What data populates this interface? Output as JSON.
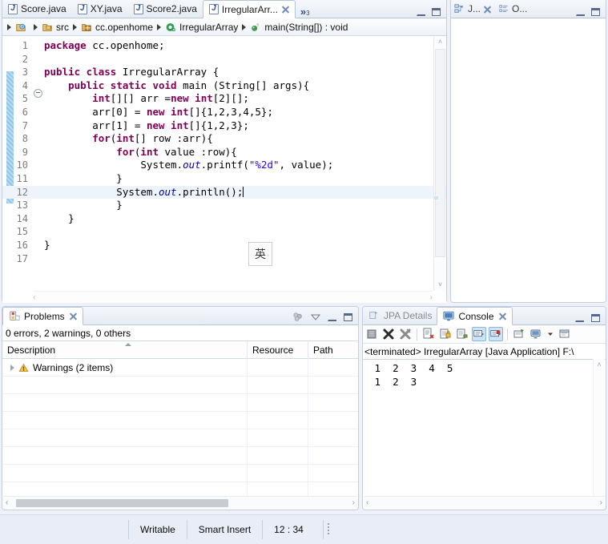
{
  "editor": {
    "tabs": [
      {
        "label": "Score.java",
        "icon": "java-file-icon",
        "active": false,
        "closable": false
      },
      {
        "label": "XY.java",
        "icon": "java-file-icon",
        "active": false,
        "closable": false
      },
      {
        "label": "Score2.java",
        "icon": "java-file-icon",
        "active": false,
        "closable": false
      },
      {
        "label": "IrregularArr...",
        "icon": "java-file-icon",
        "active": true,
        "closable": true
      }
    ],
    "more_tabs_chevron": "»",
    "more_tabs_count": "3",
    "minimize_icon": "minimize-icon",
    "maximize_icon": "maximize-icon",
    "breadcrumb": [
      {
        "label": "",
        "icon": "project-icon"
      },
      {
        "label": "src",
        "icon": "source-folder-icon"
      },
      {
        "label": "cc.openhome",
        "icon": "package-icon"
      },
      {
        "label": "IrregularArray",
        "icon": "class-icon"
      },
      {
        "label": "main(String[]) : void",
        "icon": "method-public-static-icon"
      }
    ],
    "code_lines": [
      {
        "num": "1",
        "fold": false,
        "tokens": [
          {
            "t": "package ",
            "c": "kw"
          },
          {
            "t": "cc.openhome;",
            "c": "plain"
          }
        ]
      },
      {
        "num": "2",
        "fold": false,
        "tokens": []
      },
      {
        "num": "3",
        "fold": false,
        "tokens": [
          {
            "t": "public class ",
            "c": "kw"
          },
          {
            "t": "IrregularArray {",
            "c": "plain"
          }
        ]
      },
      {
        "num": "4",
        "fold": true,
        "tokens": [
          {
            "t": "    ",
            "c": "plain"
          },
          {
            "t": "public static void ",
            "c": "kw"
          },
          {
            "t": "main (String[] args){",
            "c": "plain"
          }
        ]
      },
      {
        "num": "5",
        "fold": false,
        "tokens": [
          {
            "t": "        ",
            "c": "plain"
          },
          {
            "t": "int",
            "c": "kw"
          },
          {
            "t": "[][] arr =",
            "c": "plain"
          },
          {
            "t": "new int",
            "c": "kw"
          },
          {
            "t": "[2][];",
            "c": "plain"
          }
        ]
      },
      {
        "num": "6",
        "fold": false,
        "tokens": [
          {
            "t": "        arr[0] = ",
            "c": "plain"
          },
          {
            "t": "new int",
            "c": "kw"
          },
          {
            "t": "[]{1,2,3,4,5};",
            "c": "plain"
          }
        ]
      },
      {
        "num": "7",
        "fold": false,
        "tokens": [
          {
            "t": "        arr[1] = ",
            "c": "plain"
          },
          {
            "t": "new int",
            "c": "kw"
          },
          {
            "t": "[]{1,2,3};",
            "c": "plain"
          }
        ]
      },
      {
        "num": "8",
        "fold": false,
        "tokens": [
          {
            "t": "        ",
            "c": "plain"
          },
          {
            "t": "for",
            "c": "kw"
          },
          {
            "t": "(",
            "c": "plain"
          },
          {
            "t": "int",
            "c": "kw"
          },
          {
            "t": "[] row :arr){",
            "c": "plain"
          }
        ]
      },
      {
        "num": "9",
        "fold": false,
        "tokens": [
          {
            "t": "            ",
            "c": "plain"
          },
          {
            "t": "for",
            "c": "kw"
          },
          {
            "t": "(",
            "c": "plain"
          },
          {
            "t": "int",
            "c": "kw"
          },
          {
            "t": " value :row){",
            "c": "plain"
          }
        ]
      },
      {
        "num": "10",
        "fold": false,
        "tokens": [
          {
            "t": "                System.",
            "c": "plain"
          },
          {
            "t": "out",
            "c": "fld"
          },
          {
            "t": ".printf(",
            "c": "plain"
          },
          {
            "t": "\"%2d\"",
            "c": "str"
          },
          {
            "t": ", value);",
            "c": "plain"
          }
        ]
      },
      {
        "num": "11",
        "fold": false,
        "tokens": [
          {
            "t": "            }",
            "c": "plain"
          }
        ]
      },
      {
        "num": "12",
        "fold": false,
        "current": true,
        "caret": true,
        "tokens": [
          {
            "t": "            System.",
            "c": "plain"
          },
          {
            "t": "out",
            "c": "fld"
          },
          {
            "t": ".println();",
            "c": "plain"
          }
        ]
      },
      {
        "num": "13",
        "fold": false,
        "tokens": [
          {
            "t": "            }",
            "c": "plain"
          }
        ]
      },
      {
        "num": "14",
        "fold": false,
        "tokens": [
          {
            "t": "    }",
            "c": "plain"
          }
        ]
      },
      {
        "num": "15",
        "fold": false,
        "tokens": []
      },
      {
        "num": "16",
        "fold": false,
        "tokens": [
          {
            "t": "}",
            "c": "plain"
          }
        ]
      },
      {
        "num": "17",
        "fold": false,
        "tokens": []
      }
    ],
    "ime_indicator": "英",
    "scroll_left_arrow": "‹",
    "scroll_right_arrow": "›",
    "scroll_up_arrow": "˄",
    "scroll_down_arrow": "˅"
  },
  "right_top": {
    "tabs": [
      {
        "label": "J...",
        "icon": "hierarchy-icon",
        "active": false,
        "closable": true
      },
      {
        "label": "O...",
        "icon": "outline-icon",
        "active": false,
        "closable": false
      }
    ],
    "minimize_icon": "minimize-icon",
    "maximize_icon": "maximize-icon"
  },
  "problems": {
    "tab_label": "Problems",
    "tab_icon": "problems-icon",
    "summary": "0 errors, 2 warnings, 0 others",
    "toolbar": [
      "filters-icon",
      "view-menu-icon",
      "minimize-icon",
      "maximize-icon"
    ],
    "columns": [
      "Description",
      "Resource",
      "Path"
    ],
    "rows": [
      {
        "description": "Warnings (2 items)",
        "resource": "",
        "path": "",
        "icon": "warning-icon",
        "expandable": true
      }
    ],
    "scroll_left_arrow": "‹",
    "scroll_right_arrow": "›"
  },
  "console": {
    "tabs": [
      {
        "label": "JPA Details",
        "icon": "jpa-icon",
        "active": false,
        "closable": false
      },
      {
        "label": "Console",
        "icon": "console-icon",
        "active": true,
        "closable": true
      }
    ],
    "toolbar_icons": [
      "terminate-all-icon",
      "remove-launch-icon",
      "remove-all-terminated-icon",
      "clear-console-icon",
      "scroll-lock-icon",
      "word-wrap-icon",
      "show-console-on-output-icon",
      "pin-console-icon",
      "display-selected-console-icon",
      "open-console-icon",
      "console-menu-arrow",
      "new-console-view-icon"
    ],
    "header": "<terminated> IrregularArray [Java Application] F:\\",
    "output": [
      " 1  2  3  4  5",
      " 1  2  3"
    ],
    "minimize_icon": "minimize-icon",
    "maximize_icon": "maximize-icon",
    "scroll_up_arrow": "˄",
    "scroll_left_arrow": "‹",
    "scroll_right_arrow": "›"
  },
  "statusbar": {
    "writable": "Writable",
    "insert_mode": "Smart Insert",
    "position": "12 : 34"
  },
  "colors": {
    "keyword": "#7f0055",
    "string": "#2a00ff",
    "field": "#0000c0",
    "tab_border": "#b6c4d8",
    "panel_bg": "#eef1f7",
    "change_bar": "#8fc5ea"
  }
}
